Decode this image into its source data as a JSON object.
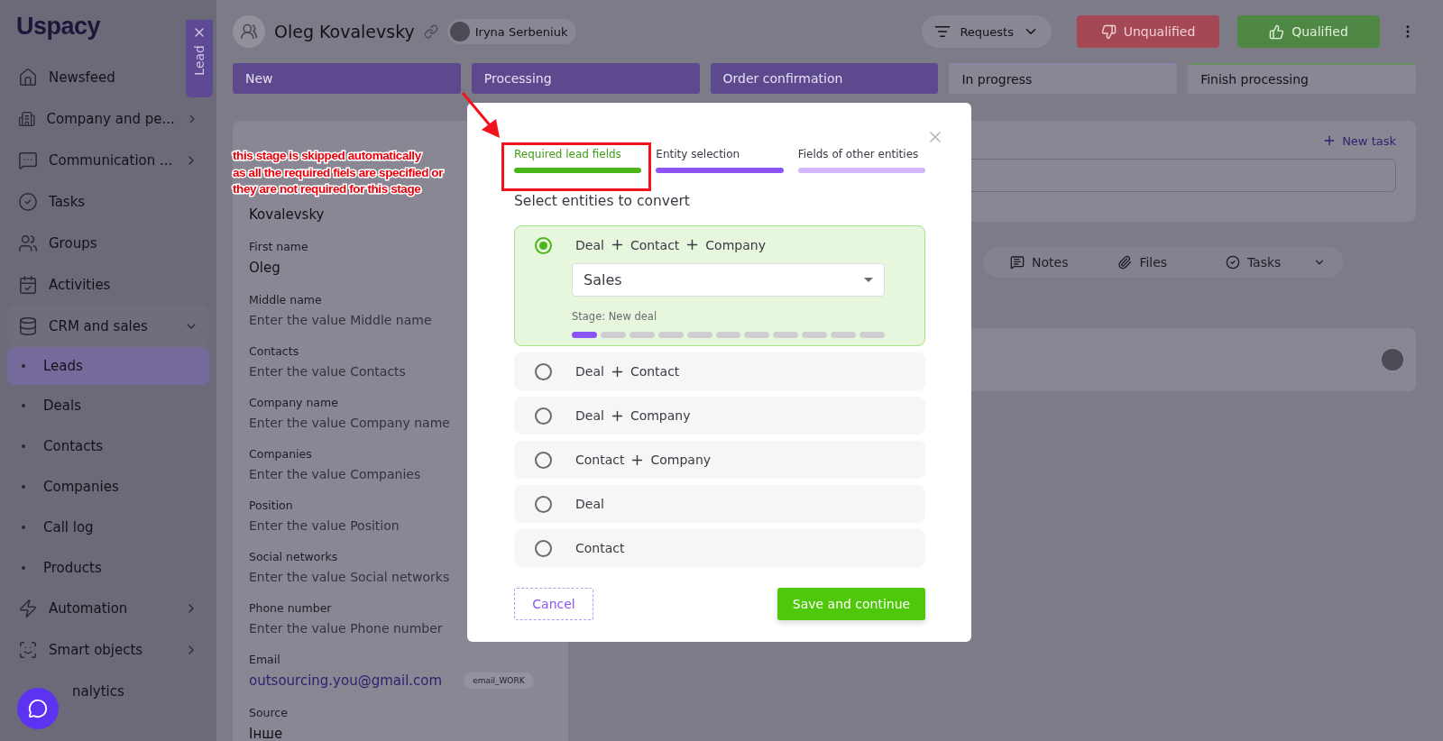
{
  "sidebar": {
    "logo": "Uspacy",
    "items": [
      {
        "label": "Newsfeed"
      },
      {
        "label": "Company and pe...",
        "expanded": false
      },
      {
        "label": "Communication ...",
        "expanded": false
      },
      {
        "label": "Tasks"
      },
      {
        "label": "Groups"
      },
      {
        "label": "Activities"
      },
      {
        "label": "CRM and sales",
        "expanded": true,
        "children": [
          {
            "label": "Leads",
            "selected": true
          },
          {
            "label": "Deals",
            "selected": false
          },
          {
            "label": "Contacts",
            "selected": false
          },
          {
            "label": "Companies",
            "selected": false
          },
          {
            "label": "Call log",
            "selected": false
          },
          {
            "label": "Products",
            "selected": false
          }
        ]
      },
      {
        "label": "Automation",
        "expanded": false
      },
      {
        "label": "Smart objects",
        "expanded": false
      },
      {
        "label": "nalytics"
      }
    ]
  },
  "side_tab": {
    "label": "Lead"
  },
  "header": {
    "title": "Oleg Kovalevsky",
    "responsible": "Iryna Serbeniuk",
    "filter": "Requests",
    "buttons": [
      {
        "label": "Unqualified",
        "kind": "negative"
      },
      {
        "label": "Qualified",
        "kind": "positive"
      }
    ]
  },
  "stages": [
    {
      "label": "New",
      "passed": true,
      "color": "#5d4a8e"
    },
    {
      "label": "Processing",
      "passed": true,
      "color": "#5d4a8e"
    },
    {
      "label": "Order confirmation",
      "passed": true,
      "color": "#5d4a8e"
    },
    {
      "label": "In progress",
      "passed": false,
      "color": "#8a84a8"
    },
    {
      "label": "Finish processing",
      "passed": false,
      "color": "#6b8e62"
    }
  ],
  "lead_fields": [
    {
      "value": "Kovalevsky"
    },
    {
      "label": "First name",
      "value": "Oleg"
    },
    {
      "label": "Middle name",
      "placeholder": "Enter the value Middle name"
    },
    {
      "label": "Contacts",
      "placeholder": "Enter the value Contacts"
    },
    {
      "label": "Company name",
      "placeholder": "Enter the value Company name"
    },
    {
      "label": "Companies",
      "placeholder": "Enter the value Companies"
    },
    {
      "label": "Position",
      "placeholder": "Enter the value Position"
    },
    {
      "label": "Social networks",
      "placeholder": "Enter the value Social networks"
    },
    {
      "label": "Phone number",
      "placeholder": "Enter the value Phone number"
    },
    {
      "label": "Email",
      "value": "outsourcing.you@gmail.com",
      "kind": "link",
      "tag": "email_WORK"
    },
    {
      "label": "Source",
      "value": "Інше"
    }
  ],
  "tasks_card": {
    "action": "New task"
  },
  "timeline_tabs": [
    {
      "label": "Notes"
    },
    {
      "label": "Files"
    },
    {
      "label": "Tasks"
    }
  ],
  "modal": {
    "steps": [
      {
        "label": "Required lead fields",
        "done": true,
        "current": false
      },
      {
        "label": "Entity selection",
        "done": false,
        "current": true
      },
      {
        "label": "Fields of other entities",
        "done": false,
        "current": false
      }
    ],
    "heading": "Select entities to convert",
    "options": [
      {
        "entities": [
          "Deal",
          "Contact",
          "Company"
        ],
        "selected": true,
        "pipeline": "Sales",
        "stage": "Stage: New deal",
        "segments": [
          {
            "done": true
          },
          {
            "done": false
          },
          {
            "done": false
          },
          {
            "done": false
          },
          {
            "done": false
          },
          {
            "done": false
          },
          {
            "done": false
          },
          {
            "done": false
          },
          {
            "done": false
          },
          {
            "done": false
          },
          {
            "done": false
          }
        ]
      },
      {
        "entities": [
          "Deal",
          "Contact"
        ],
        "selected": false
      },
      {
        "entities": [
          "Deal",
          "Company"
        ],
        "selected": false
      },
      {
        "entities": [
          "Contact",
          "Company"
        ],
        "selected": false
      },
      {
        "entities": [
          "Deal"
        ],
        "selected": false
      },
      {
        "entities": [
          "Contact"
        ],
        "selected": false
      }
    ],
    "cancel": "Cancel",
    "submit": "Save and continue"
  },
  "annotation": {
    "text": "this stage is skipped automatically\nas all the required fiels are specified or\nthey are not required for this stage"
  }
}
